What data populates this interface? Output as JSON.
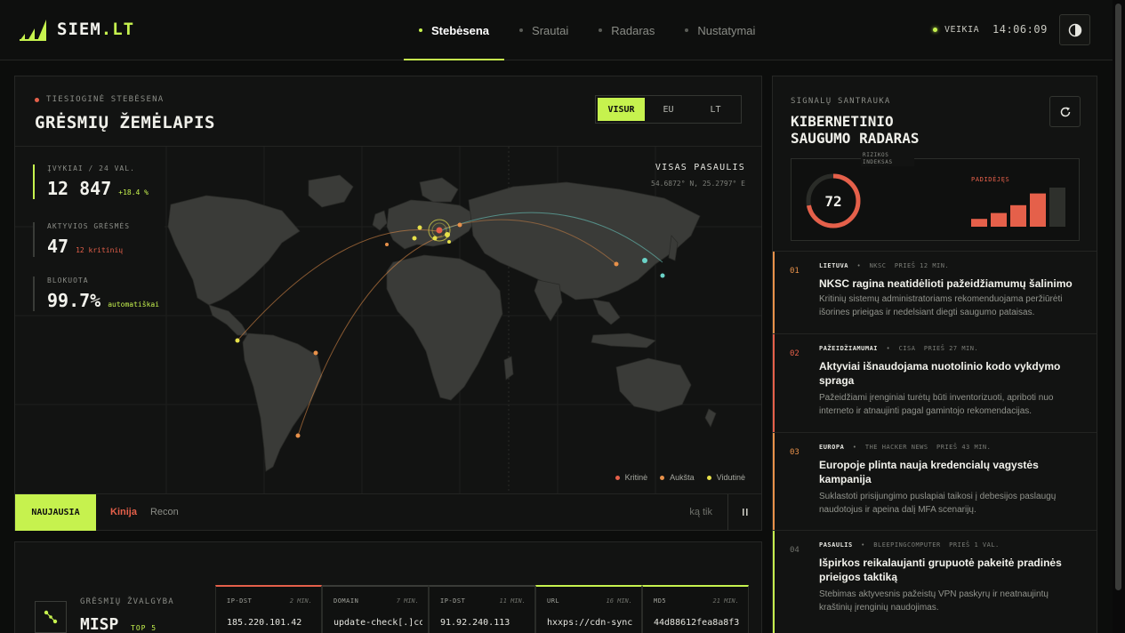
{
  "app": {
    "logo_text": "SIEM",
    "logo_suffix": ".LT",
    "status": "VEIKIA",
    "clock": "14:06:09"
  },
  "nav": {
    "items": [
      {
        "label": "Stebėsena",
        "active": true
      },
      {
        "label": "Srautai",
        "active": false
      },
      {
        "label": "Radaras",
        "active": false
      },
      {
        "label": "Nustatymai",
        "active": false
      }
    ]
  },
  "map_panel": {
    "eyebrow": "TIESIOGINĖ STEBĖSENA",
    "title": "GRĖSMIŲ ŽEMĖLAPIS",
    "scopes": [
      "VISUR",
      "EU",
      "LT"
    ],
    "active_scope": "VISUR",
    "region_label": "VISAS PASAULIS",
    "coords": "54.6872° N, 25.2797° E",
    "stats": [
      {
        "label": "ĮVYKIAI / 24 VAL.",
        "value": "12 847",
        "sub": "+18.4 %",
        "sub_color": "#c6f24e"
      },
      {
        "label": "AKTYVIOS GRĖSMĖS",
        "value": "47",
        "sub": "12 kritinių",
        "sub_color": "#e5604a"
      },
      {
        "label": "BLOKUOTA",
        "value": "99.7%",
        "sub": "automatiškai",
        "sub_color": "#c6f24e"
      }
    ],
    "legend": [
      {
        "label": "Kritinė",
        "color": "#e5604a"
      },
      {
        "label": "Aukšta",
        "color": "#e8914a"
      },
      {
        "label": "Vidutinė",
        "color": "#e6e04a"
      }
    ],
    "tabs": {
      "active": "NAUJAUSIA",
      "items": [
        "Kinija",
        "Recon"
      ]
    },
    "hint": "ką tik"
  },
  "side_panel": {
    "eyebrow": "SIGNALŲ SANTRAUKA",
    "title_line1": "KIBERNETINIO",
    "title_line2": "SAUGUMO RADARAS",
    "risk_label": "RIZIKOS INDEKSAS",
    "risk_value": "72",
    "risk_fraction": 0.72,
    "trend_label": "PADIDĖJĘS",
    "trend_bars": [
      0.2,
      0.35,
      0.55,
      0.85,
      1.0
    ],
    "news": [
      {
        "num": "01",
        "tag": "LIETUVA",
        "source": "NKSC",
        "time": "PRIEŠ 12 MIN.",
        "headline": "NKSC ragina neatidėlioti pažeidžiamumų šalinimo",
        "desc": "Kritinių sistemų administratoriams rekomenduojama peržiūrėti išorines prieigas ir nedelsiant diegti saugumo pataisas.",
        "color": "#e8914a"
      },
      {
        "num": "02",
        "tag": "PAŽEIDŽIAMUMAI",
        "source": "CISA",
        "time": "PRIEŠ 27 MIN.",
        "headline": "Aktyviai išnaudojama nuotolinio kodo vykdymo spraga",
        "desc": "Pažeidžiami įrenginiai turėtų būti inventorizuoti, apriboti nuo interneto ir atnaujinti pagal gamintojo rekomendacijas.",
        "color": "#e5604a"
      },
      {
        "num": "03",
        "tag": "EUROPA",
        "source": "THE HACKER NEWS",
        "time": "PRIEŠ 43 MIN.",
        "headline": "Europoje plinta nauja kredencialų vagystės kampanija",
        "desc": "Suklastoti prisijungimo puslapiai taikosi į debesijos paslaugų naudotojus ir apeina dalį MFA scenarijų.",
        "color": "#e8914a"
      },
      {
        "num": "04",
        "tag": "PASAULIS",
        "source": "BLEEPINGCOMPUTER",
        "time": "PRIEŠ 1 VAL.",
        "headline": "Išpirkos reikalaujanti grupuotė pakeitė pradinės prieigos taktiką",
        "desc": "Stebimas aktyvesnis pažeistų VPN paskyrų ir neatnaujintų kraštinių įrenginių naudojimas.",
        "color": "#c6f24e"
      }
    ]
  },
  "intel": {
    "eyebrow": "GRĖSMIŲ ŽVALGYBA",
    "title": "MISP",
    "badge": "TOP 5",
    "iocs": [
      {
        "type": "IP-DST",
        "ago": "2 MIN.",
        "value": "185.220.101.42",
        "color": "#e5604a"
      },
      {
        "type": "DOMAIN",
        "ago": "7 MIN.",
        "value": "update-check[.]com",
        "color": "#3a3c38"
      },
      {
        "type": "IP-DST",
        "ago": "11 MIN.",
        "value": "91.92.240.113",
        "color": "#3a3c38"
      },
      {
        "type": "URL",
        "ago": "16 MIN.",
        "value": "hxxps://cdn-sync",
        "color": "#c6f24e"
      },
      {
        "type": "MD5",
        "ago": "21 MIN.",
        "value": "44d88612fea8a8f3",
        "color": "#c6f24e"
      }
    ]
  },
  "colors": {
    "accent": "#c6f24e",
    "critical": "#e5604a",
    "high": "#e8914a",
    "medium": "#e6e04a"
  }
}
